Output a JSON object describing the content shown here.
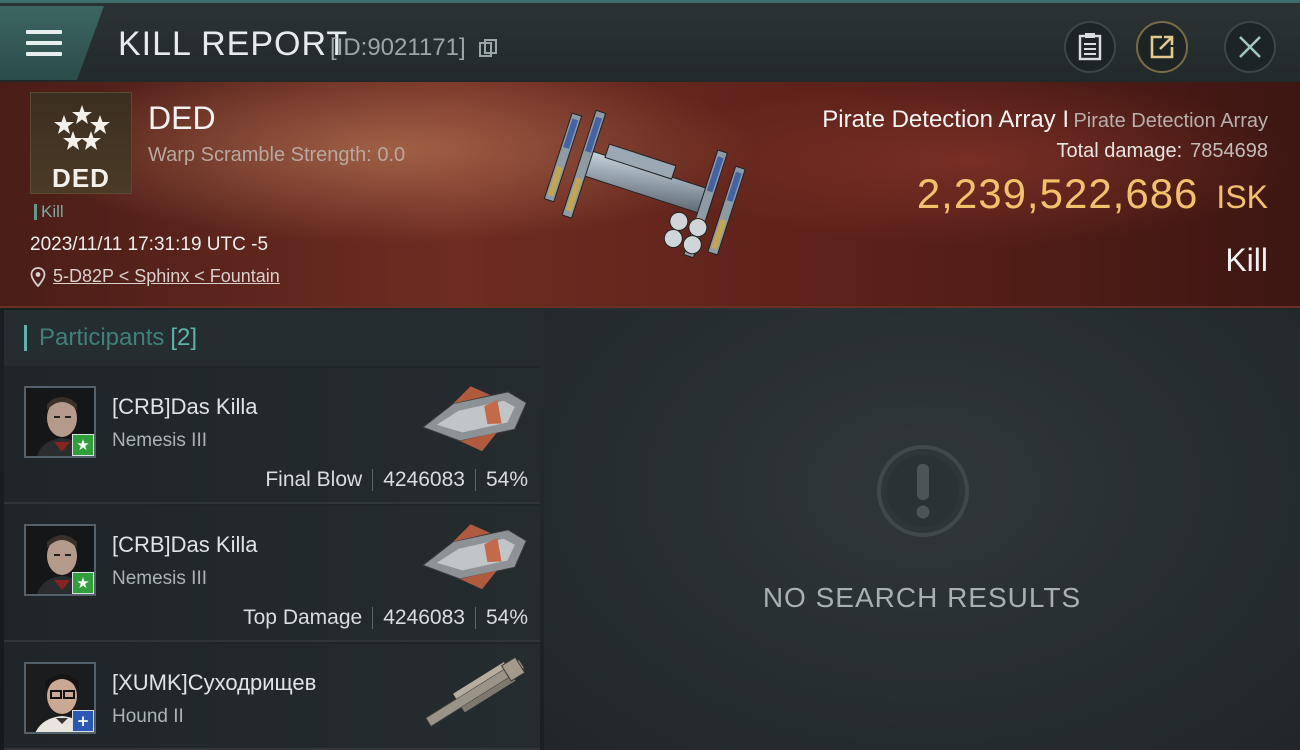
{
  "header": {
    "title": "KILL REPORT",
    "report_id": "[ID:9021171]",
    "icons": {
      "menu": "hamburger-menu-icon",
      "copy": "copy-icon",
      "clipboard": "clipboard-icon",
      "share": "share-icon",
      "close": "close-icon"
    }
  },
  "victim": {
    "corp_logo_text": "DED",
    "corp_name": "DED",
    "warp_scramble": "Warp Scramble Strength: 0.0",
    "tag": "Kill",
    "timestamp": "2023/11/11 17:31:19 UTC -5",
    "location": "5-D82P < Sphinx < Fountain",
    "name": "Pirate Detection Array I",
    "type": "Pirate Detection Array",
    "total_damage_label": "Total damage:",
    "total_damage": "7854698",
    "isk_value": "2,239,522,686",
    "isk_unit": "ISK",
    "result": "Kill"
  },
  "participants": {
    "label": "Participants",
    "count": "[2]",
    "items": [
      {
        "name": "[CRB]Das Killa",
        "ship": "Nemesis III",
        "role": "Final Blow",
        "damage": "4246083",
        "percent": "54%",
        "badge": "★"
      },
      {
        "name": "[CRB]Das Killa",
        "ship": "Nemesis III",
        "role": "Top Damage",
        "damage": "4246083",
        "percent": "54%",
        "badge": "★"
      },
      {
        "name": "[XUMK]Суходрищев",
        "ship": "Hound II",
        "badge": "+"
      }
    ]
  },
  "results_panel": {
    "empty_text": "NO SEARCH RESULTS",
    "icon": "exclamation-circle-icon"
  },
  "colors": {
    "accent_teal": "#5fb4aa",
    "isk_gold": "#f2c26b",
    "hero_red": "#6e2c22",
    "badge_green": "#2f9f3a",
    "badge_blue": "#2a58b8"
  }
}
